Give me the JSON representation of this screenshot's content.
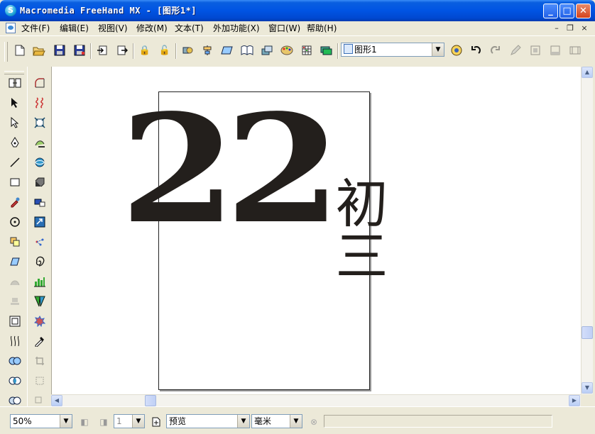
{
  "window": {
    "title": "Macromedia FreeHand MX - [图形1*]",
    "app_icon_glyph": "S",
    "minimize_glyph": "_",
    "maximize_glyph": "□",
    "close_glyph": "✕"
  },
  "menu": {
    "items": [
      "文件(F)",
      "编辑(E)",
      "视图(V)",
      "修改(M)",
      "文本(T)",
      "外加功能(X)",
      "窗口(W)",
      "帮助(H)"
    ],
    "mdi_minimize": "–",
    "mdi_restore": "❐",
    "mdi_close": "×"
  },
  "toolbar": {
    "icons": [
      "new-icon",
      "open-icon",
      "save-icon",
      "save-as-icon",
      "import-icon",
      "export-icon",
      "lock-icon",
      "unlock-icon",
      "group-icon",
      "align-icon",
      "transform-icon",
      "library-icon",
      "symbols-icon",
      "color-mixer-icon",
      "swatches-icon",
      "layers-icon"
    ],
    "page_selector_value": "图形1",
    "right_icons": [
      "navigate-icon",
      "undo-icon",
      "redo-icon",
      "pencil-icon",
      "frame-icon",
      "frame2-icon",
      "frame3-icon"
    ]
  },
  "toolbox": {
    "left": [
      "page-tool-icon",
      "pointer-tool-icon",
      "subselect-tool-icon",
      "pen-tool-icon",
      "line-tool-icon",
      "rectangle-tool-icon",
      "eyedropper-tool-icon",
      "rotate-tool-icon",
      "reflect-tool-icon",
      "skew-tool-icon",
      "scale-tool-icon",
      "stamp-tool-icon",
      "inset-path-icon",
      "blend-tool-icon",
      "union-icon",
      "intersect-icon",
      "punch-icon"
    ],
    "right": [
      "arc-tool-icon",
      "freehand-tool-icon",
      "fisheye-icon",
      "shadow-icon",
      "3d-rotate-icon",
      "extrude-icon",
      "envelope-icon",
      "trace-icon",
      "mirror-icon",
      "spiral-icon",
      "chart-tool-icon",
      "perspective-icon",
      "roughen-icon",
      "eyedropper2-icon",
      "crop-icon",
      "scale2-icon",
      "link-icon"
    ]
  },
  "canvas": {
    "big_number": "22",
    "vertical_text": "初三"
  },
  "statusbar": {
    "zoom_value": "50%",
    "page_number": "1",
    "preview_mode": "预览",
    "units": "毫米"
  },
  "colors": {
    "titlebar": "#0054e3",
    "chrome": "#ece9d8",
    "artwork": "#231f1c"
  }
}
